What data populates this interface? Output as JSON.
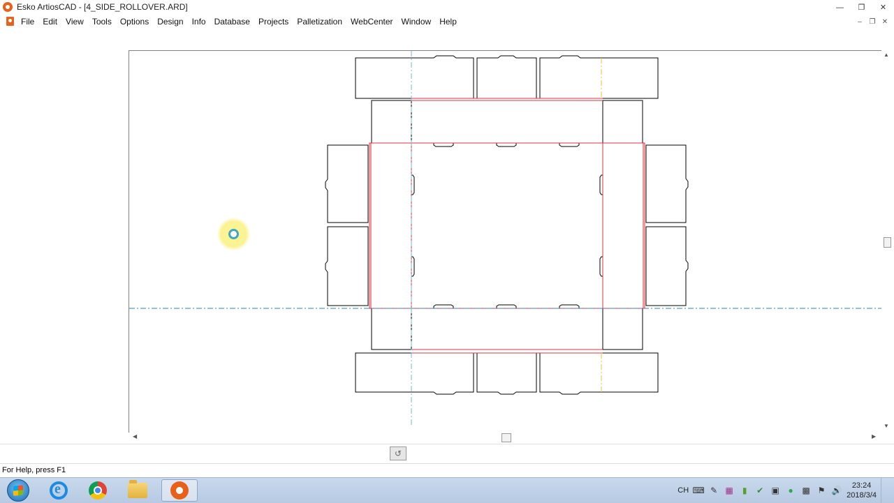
{
  "window": {
    "title": "Esko ArtiosCAD - [4_SIDE_ROLLOVER.ARD]",
    "controls": [
      "minimize",
      "restore",
      "close"
    ]
  },
  "menubar": {
    "items": [
      "File",
      "Edit",
      "View",
      "Tools",
      "Options",
      "Design",
      "Info",
      "Database",
      "Projects",
      "Palletization",
      "WebCenter",
      "Window",
      "Help"
    ]
  },
  "statusbar": {
    "text": "For Help, press F1"
  },
  "taskbar": {
    "apps": [
      {
        "name": "start-button",
        "icon": "windows-start-icon"
      },
      {
        "name": "internet-explorer",
        "icon": "ie-icon"
      },
      {
        "name": "chrome",
        "icon": "chrome-icon"
      },
      {
        "name": "file-explorer",
        "icon": "folder-icon"
      },
      {
        "name": "artioscad",
        "icon": "artioscad-icon",
        "active": true
      }
    ],
    "tray": {
      "language": "CH",
      "time": "23:24",
      "date": "2018/3/4"
    }
  },
  "colors": {
    "cut_line": "#000000",
    "crease_line": "#e03040",
    "centerline": "#2b8ab0",
    "accent": "#e8611a"
  }
}
